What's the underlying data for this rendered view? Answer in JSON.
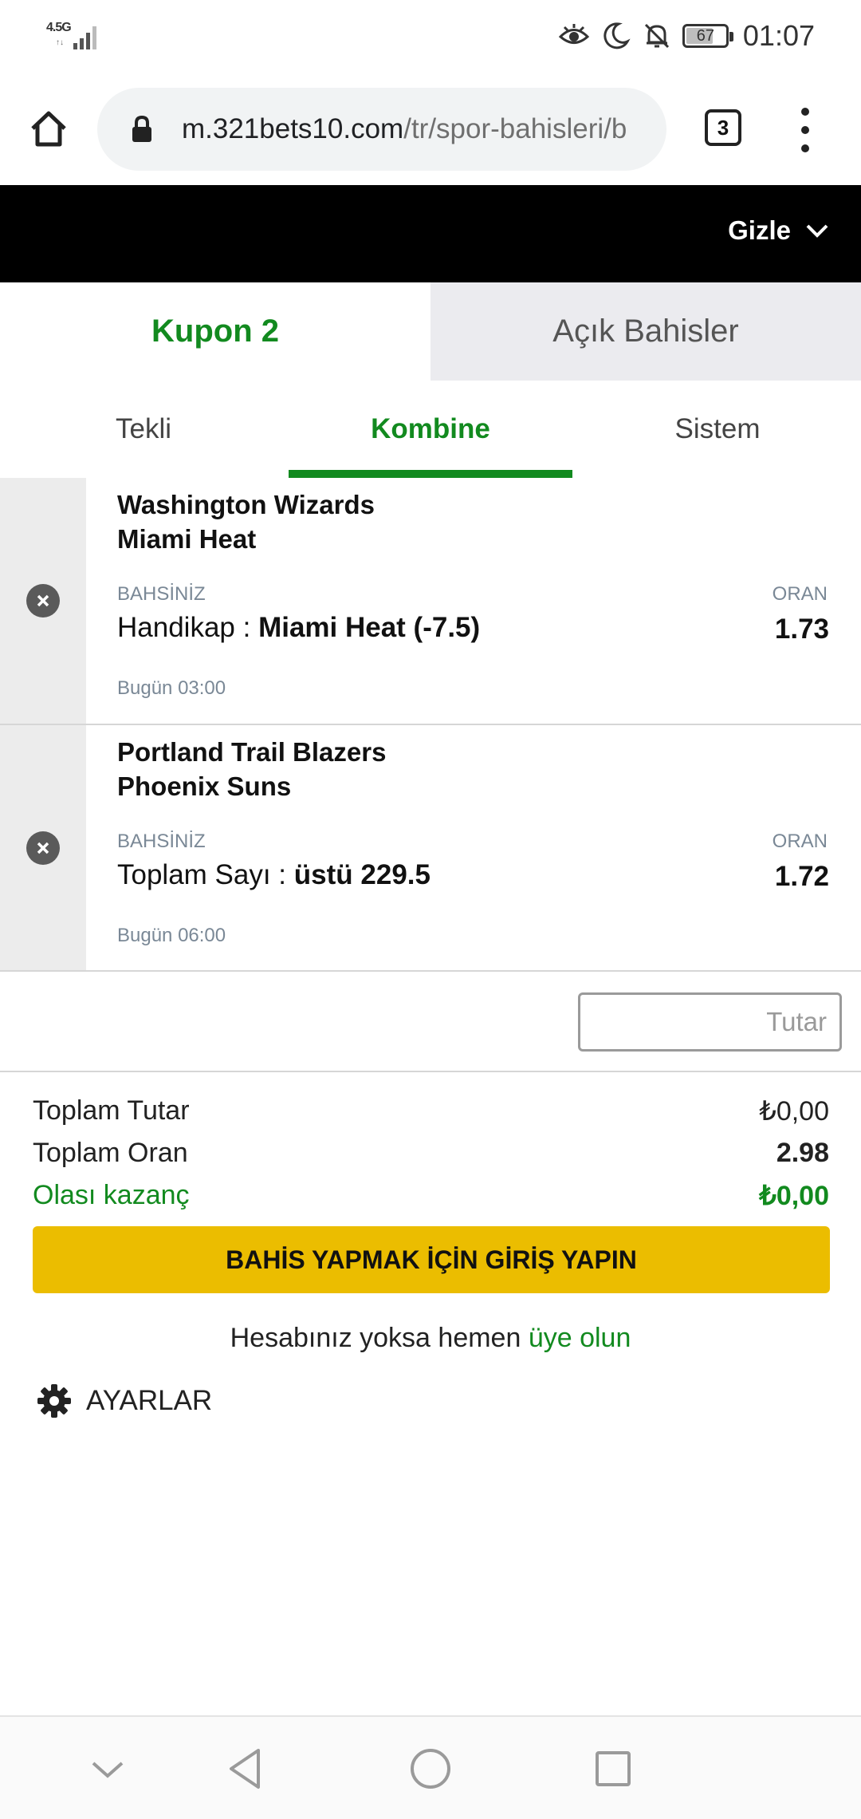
{
  "status_bar": {
    "network_label": "4.5G",
    "network_sub": "↑↓",
    "battery": "67",
    "time": "01:07"
  },
  "browser": {
    "url_host": "m.321bets10.com",
    "url_path": "/tr/spor-bahisleri/b",
    "tab_count": "3"
  },
  "header": {
    "hide_label": "Gizle"
  },
  "coupon_tabs": [
    {
      "label": "Kupon 2",
      "active": true
    },
    {
      "label": "Açık Bahisler",
      "active": false
    }
  ],
  "bet_type_tabs": [
    {
      "label": "Tekli",
      "active": false
    },
    {
      "label": "Kombine",
      "active": true
    },
    {
      "label": "Sistem",
      "active": false
    }
  ],
  "selections": [
    {
      "home": "Washington Wizards",
      "away": "Miami Heat",
      "bet_label": "BAHSİNİZ",
      "odds_label": "ORAN",
      "market": "Handikap :",
      "pick": "Miami Heat (-7.5)",
      "odds": "1.73",
      "time": "Bugün 03:00"
    },
    {
      "home": "Portland Trail Blazers",
      "away": "Phoenix Suns",
      "bet_label": "BAHSİNİZ",
      "odds_label": "ORAN",
      "market": "Toplam Sayı :",
      "pick": "üstü 229.5",
      "odds": "1.72",
      "time": "Bugün 06:00"
    }
  ],
  "stake": {
    "placeholder": "Tutar",
    "value": ""
  },
  "summary": {
    "total_stake_label": "Toplam Tutar",
    "total_stake_value": "₺0,00",
    "total_odds_label": "Toplam Oran",
    "total_odds_value": "2.98",
    "potential_win_label": "Olası kazanç",
    "potential_win_value": "₺0,00"
  },
  "login_button": "BAHİS YAPMAK İÇİN GİRİŞ YAPIN",
  "signup": {
    "text": "Hesabınız yoksa hemen",
    "link": "üye olun"
  },
  "settings_label": "AYARLAR",
  "colors": {
    "accent_green": "#128a1f",
    "login_yellow": "#ebbd00",
    "header_black": "#000000"
  },
  "icons": [
    "eye-icon",
    "moon-icon",
    "bell-off-icon",
    "home-icon",
    "lock-icon",
    "close-icon",
    "chevron-down-icon",
    "gear-icon",
    "back-icon",
    "recents-icon"
  ]
}
